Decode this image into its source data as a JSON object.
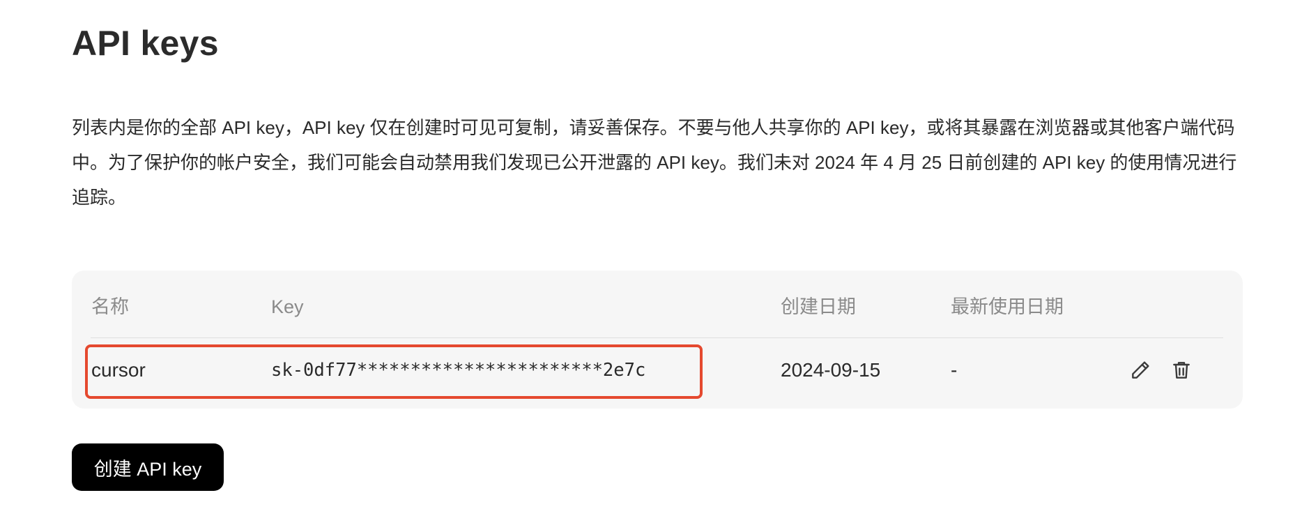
{
  "page": {
    "title": "API keys",
    "description": "列表内是你的全部 API key，API key 仅在创建时可见可复制，请妥善保存。不要与他人共享你的 API key，或将其暴露在浏览器或其他客户端代码中。为了保护你的帐户安全，我们可能会自动禁用我们发现已公开泄露的 API key。我们未对 2024 年 4 月 25 日前创建的 API key 的使用情况进行追踪。"
  },
  "table": {
    "headers": {
      "name": "名称",
      "key": "Key",
      "created": "创建日期",
      "last_used": "最新使用日期"
    },
    "rows": [
      {
        "name": "cursor",
        "key": "sk-0df77***********************2e7c",
        "created": "2024-09-15",
        "last_used": "-"
      }
    ]
  },
  "actions": {
    "create_label": "创建 API key",
    "edit_icon": "pencil-icon",
    "delete_icon": "trash-icon"
  },
  "colors": {
    "highlight_border": "#e5492f",
    "table_bg": "#f6f6f6",
    "button_bg": "#000000"
  }
}
